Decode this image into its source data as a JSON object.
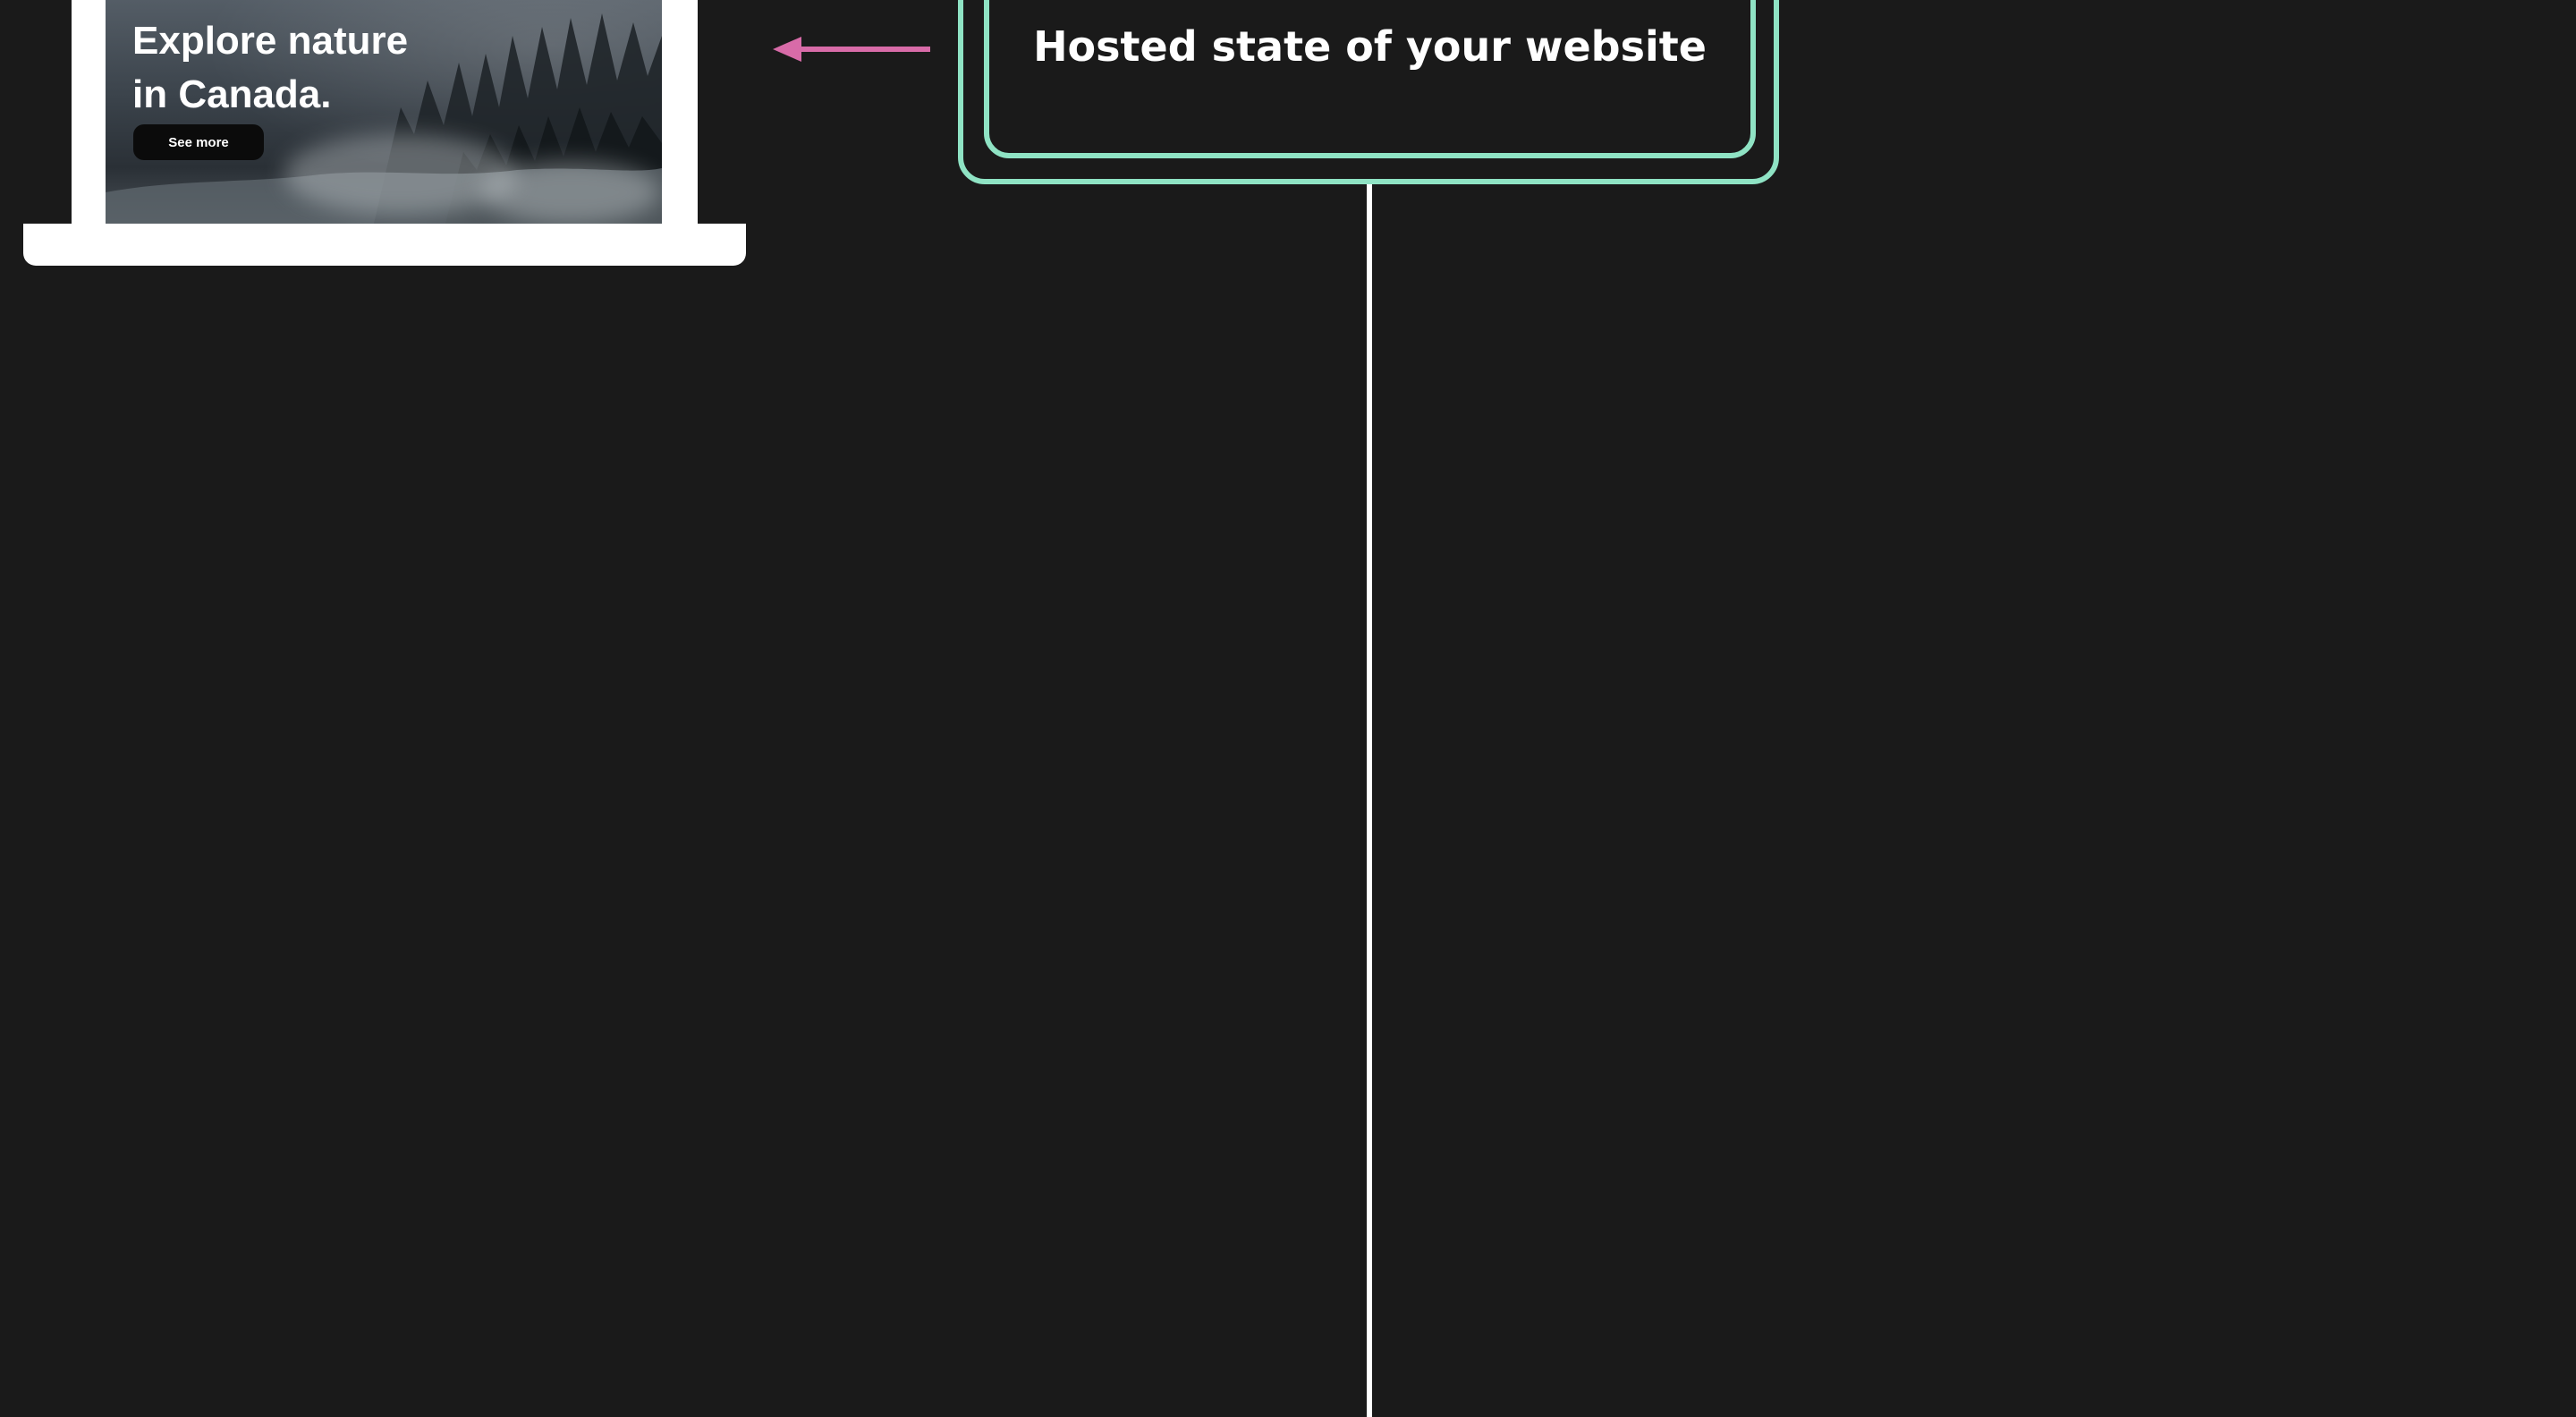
{
  "laptop": {
    "hero_title": "Explore nature\nin Canada.",
    "cta_label": "See more"
  },
  "arrow": {
    "color": "#d86ba8",
    "direction": "left"
  },
  "hosted_state": {
    "label": "Hosted state of your website",
    "border_color": "#8fe3c4"
  },
  "connector": {
    "color": "#ffffff"
  },
  "colors": {
    "background": "#1a1a1a"
  }
}
